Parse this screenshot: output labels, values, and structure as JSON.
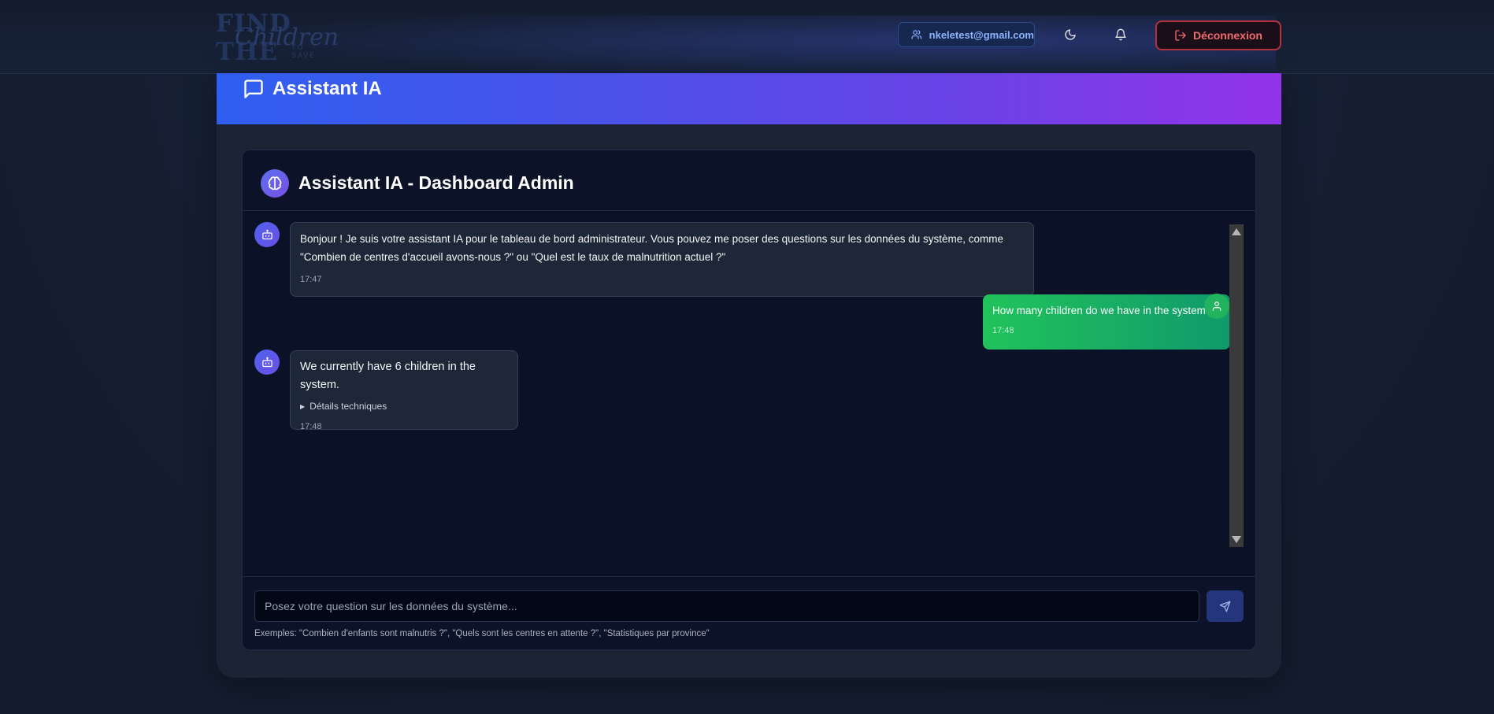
{
  "navbar": {
    "logo": {
      "line1": "FIND THE",
      "line2": "Children",
      "line3": "TO SAVE"
    },
    "user_email": "nkeletest@gmail.com",
    "logout_label": "Déconnexion",
    "icons": [
      "users-icon",
      "moon-icon",
      "bell-icon",
      "logout-icon"
    ]
  },
  "banner": {
    "title": "Assistant IA",
    "icon": "message-square-icon"
  },
  "chat": {
    "title": "Assistant IA - Dashboard Admin",
    "header_icon": "brain-icon",
    "messages": [
      {
        "role": "bot",
        "text_line1": "Bonjour ! Je suis votre assistant IA pour le tableau de bord administrateur. Vous pouvez me poser des questions sur les données du système, comme",
        "text_line2": "\"Combien de centres d'accueil avons-nous ?\" ou \"Quel est le taux de malnutrition actuel ?\"",
        "time": "17:47"
      },
      {
        "role": "user",
        "text": "How many children do we have in the system ?",
        "time": "17:48"
      },
      {
        "role": "bot",
        "text": "We currently have 6 children in the system.",
        "details_label": "Détails techniques",
        "time": "17:48"
      }
    ],
    "input": {
      "placeholder": "Posez votre question sur les données du système...",
      "value": ""
    },
    "examples": "Exemples: \"Combien d'enfants sont malnutris ?\", \"Quels sont les centres en attente ?\", \"Statistiques par province\""
  },
  "colors": {
    "banner_start": "#2f5ff0",
    "banner_end": "#9333ea",
    "user_bubble": "#21c35b",
    "logout_border": "#b3323d",
    "accent_blue": "#8fb4ff"
  }
}
